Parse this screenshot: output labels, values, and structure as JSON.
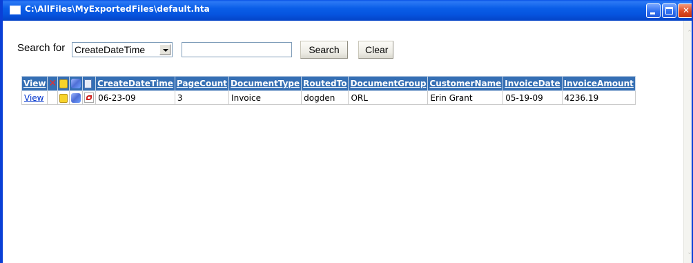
{
  "window": {
    "title": "C:\\AllFiles\\MyExportedFiles\\default.hta"
  },
  "search": {
    "label": "Search for",
    "field_selected": "CreateDateTime",
    "input_value": "",
    "search_button": "Search",
    "clear_button": "Clear"
  },
  "table": {
    "headers": [
      "View",
      "CreateDateTime",
      "PageCount",
      "DocumentType",
      "RoutedTo",
      "DocumentGroup",
      "CustomerName",
      "InvoiceDate",
      "InvoiceAmount"
    ],
    "header_icons": [
      "delete-icon",
      "note-icon",
      "attachment-icon",
      "document-icon"
    ],
    "rows": [
      {
        "view": "View",
        "row_icons": [
          "note-icon",
          "attachment-icon",
          "pdf-icon"
        ],
        "CreateDateTime": "06-23-09",
        "PageCount": "3",
        "DocumentType": "Invoice",
        "RoutedTo": "dogden",
        "DocumentGroup": "ORL",
        "CustomerName": "Erin Grant",
        "InvoiceDate": "05-19-09",
        "InvoiceAmount": "4236.19"
      }
    ]
  },
  "colors": {
    "titlebar": "#0a53e6",
    "table_header": "#356fb4",
    "link": "#0033cc",
    "close_button": "#de4a22"
  }
}
